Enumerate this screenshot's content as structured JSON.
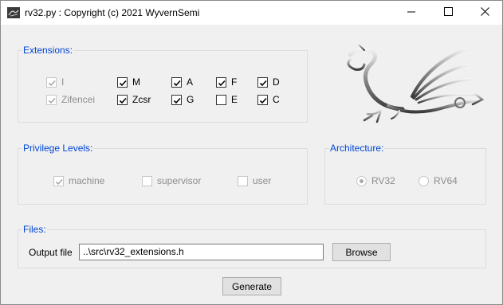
{
  "window": {
    "title": "rv32.py : Copyright (c) 2021 WyvernSemi"
  },
  "extensions": {
    "title": "Extensions:",
    "items": [
      {
        "label": "I",
        "checked": true,
        "disabled": true
      },
      {
        "label": "M",
        "checked": true,
        "disabled": false
      },
      {
        "label": "A",
        "checked": true,
        "disabled": false
      },
      {
        "label": "F",
        "checked": true,
        "disabled": false
      },
      {
        "label": "D",
        "checked": true,
        "disabled": false
      },
      {
        "label": "Zifencei",
        "checked": true,
        "disabled": true
      },
      {
        "label": "Zcsr",
        "checked": true,
        "disabled": false
      },
      {
        "label": "G",
        "checked": true,
        "disabled": false
      },
      {
        "label": "E",
        "checked": false,
        "disabled": false
      },
      {
        "label": "C",
        "checked": true,
        "disabled": false
      }
    ]
  },
  "privilege": {
    "title": "Privilege Levels:",
    "items": [
      {
        "label": "machine",
        "checked": true,
        "disabled": true
      },
      {
        "label": "supervisor",
        "checked": false,
        "disabled": true
      },
      {
        "label": "user",
        "checked": false,
        "disabled": true
      }
    ]
  },
  "architecture": {
    "title": "Architecture:",
    "options": [
      {
        "label": "RV32",
        "selected": true,
        "disabled": true
      },
      {
        "label": "RV64",
        "selected": false,
        "disabled": true
      }
    ]
  },
  "files": {
    "title": "Files:",
    "output_label": "Output file",
    "output_value": "..\\src\\rv32_extensions.h",
    "browse_label": "Browse"
  },
  "generate_label": "Generate",
  "icons": {
    "logo": "wyvern-dragon-logo",
    "app": "app-icon",
    "minimize": "minimize-icon",
    "maximize": "maximize-icon",
    "close": "close-icon",
    "check": "checkmark-icon"
  },
  "colors": {
    "group_title": "#0046d5",
    "disabled_text": "#8d8d8d",
    "window_bg": "#f0f0f0"
  }
}
